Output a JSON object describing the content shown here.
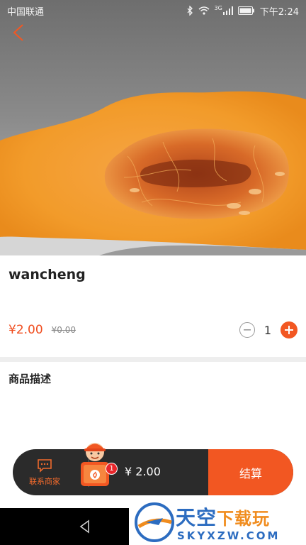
{
  "status_bar": {
    "carrier": "中国联通",
    "network": "3G",
    "time": "下午2:24",
    "icons": [
      "bluetooth-icon",
      "wifi-icon",
      "signal-icon",
      "battery-icon"
    ]
  },
  "product": {
    "image": "pumpkin-photo",
    "name": "wancheng",
    "price": "¥2.00",
    "original_price": "¥0.00",
    "quantity": "1",
    "description_title": "商品描述"
  },
  "cart_bar": {
    "contact_label": "联系商家",
    "badge_count": "1",
    "total": "¥ 2.00",
    "checkout_label": "结算"
  },
  "watermark": {
    "text_main": "天空",
    "text_accent": "下载玩",
    "url": "SKYXZW.COM"
  },
  "colors": {
    "accent": "#f25722",
    "price": "#f04d1f",
    "cart_bar_bg": "#2b2b2b",
    "badge": "#e8262b",
    "watermark_blue": "#2c6cc0"
  }
}
